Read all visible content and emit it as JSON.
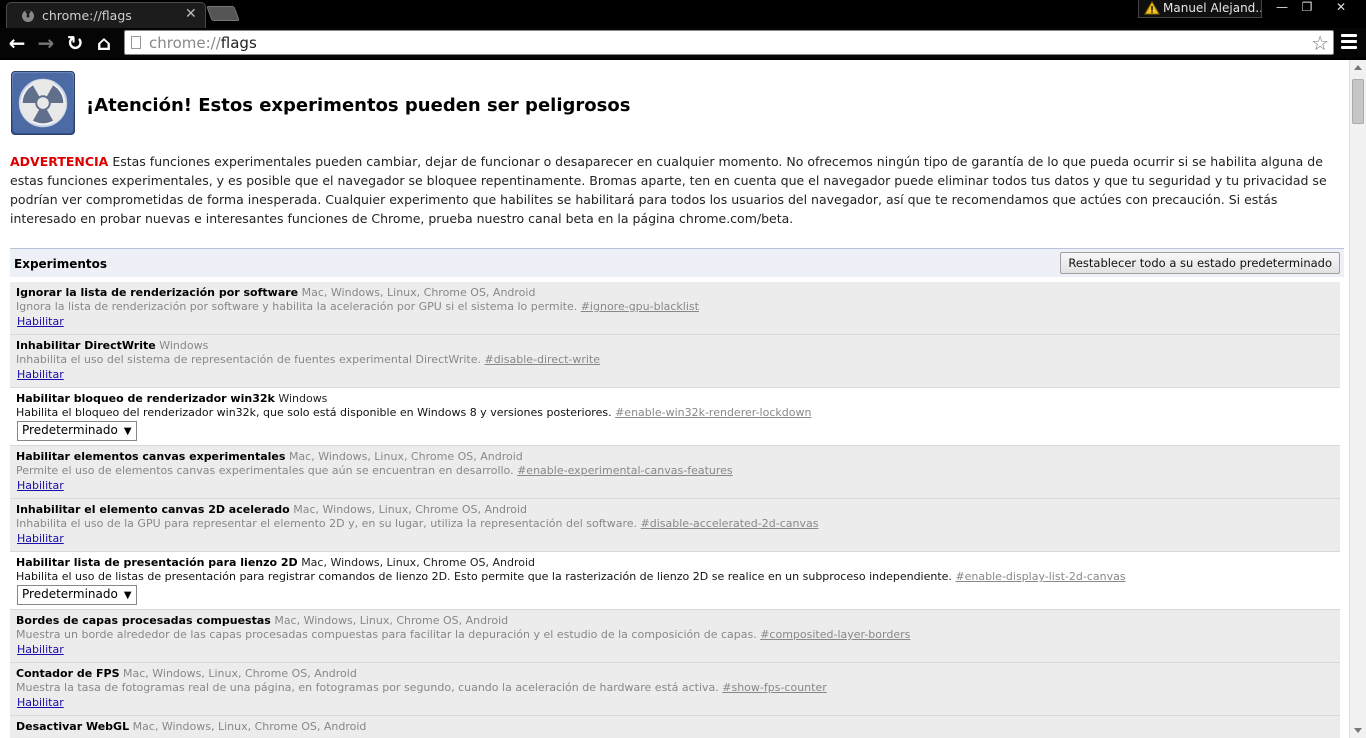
{
  "tab": {
    "title": "chrome://flags"
  },
  "profile": {
    "name": "Manuel Alejand..."
  },
  "window": {
    "minimize": "—",
    "restore": "❐",
    "close": "✕"
  },
  "nav": {
    "back": "←",
    "forward": "→",
    "reload": "↻",
    "home": "⌂"
  },
  "omnibox": {
    "scheme": "chrome://",
    "host": "flags"
  },
  "page": {
    "title": "¡Atención! Estos experimentos pueden ser peligrosos",
    "warning_label": "ADVERTENCIA",
    "warning_text": " Estas funciones experimentales pueden cambiar, dejar de funcionar o desaparecer en cualquier momento. No ofrecemos ningún tipo de garantía de lo que pueda ocurrir si se habilita alguna de estas funciones experimentales, y es posible que el navegador se bloquee repentinamente. Bromas aparte, ten en cuenta que el navegador puede eliminar todos tus datos y que tu seguridad y tu privacidad se podrían ver comprometidas de forma inesperada. Cualquier experimento que habilites se habilitará para todos los usuarios del navegador, así que te recomendamos que actúes con precaución. Si estás interesado en probar nuevas e interesantes funciones de Chrome, prueba nuestro canal beta en la página chrome.com/beta.",
    "experiments_label": "Experimentos",
    "reset_label": "Restablecer todo a su estado predeterminado"
  },
  "experiments": [
    {
      "name": "Ignorar la lista de renderización por software",
      "platforms": "Mac, Windows, Linux, Chrome OS, Android",
      "desc": "Ignora la lista de renderización por software y habilita la aceleración por GPU si el sistema lo permite.",
      "anchor": "#ignore-gpu-blacklist",
      "action": "Habilitar"
    },
    {
      "name": "Inhabilitar DirectWrite",
      "platforms": "Windows",
      "desc": "Inhabilita el uso del sistema de representación de fuentes experimental DirectWrite.",
      "anchor": "#disable-direct-write",
      "action": "Habilitar"
    },
    {
      "name": "Habilitar bloqueo de renderizador win32k",
      "platforms": "Windows",
      "desc": "Habilita el bloqueo del renderizador win32k, que solo está disponible en Windows 8 y versiones posteriores.",
      "anchor": "#enable-win32k-renderer-lockdown",
      "select": "Predeterminado"
    },
    {
      "name": "Habilitar elementos canvas experimentales",
      "platforms": "Mac, Windows, Linux, Chrome OS, Android",
      "desc": "Permite el uso de elementos canvas experimentales que aún se encuentran en desarrollo.",
      "anchor": "#enable-experimental-canvas-features",
      "action": "Habilitar"
    },
    {
      "name": "Inhabilitar el elemento canvas 2D acelerado",
      "platforms": "Mac, Windows, Linux, Chrome OS, Android",
      "desc": "Inhabilita el uso de la GPU para representar el elemento 2D y, en su lugar, utiliza la representación del software.",
      "anchor": "#disable-accelerated-2d-canvas",
      "action": "Habilitar"
    },
    {
      "name": "Habilitar lista de presentación para lienzo 2D",
      "platforms": "Mac, Windows, Linux, Chrome OS, Android",
      "desc": "Habilita el uso de listas de presentación para registrar comandos de lienzo 2D. Esto permite que la rasterización de lienzo 2D se realice en un subproceso independiente.",
      "anchor": "#enable-display-list-2d-canvas",
      "select": "Predeterminado"
    },
    {
      "name": "Bordes de capas procesadas compuestas",
      "platforms": "Mac, Windows, Linux, Chrome OS, Android",
      "desc": "Muestra un borde alrededor de las capas procesadas compuestas para facilitar la depuración y el estudio de la composición de capas.",
      "anchor": "#composited-layer-borders",
      "action": "Habilitar"
    },
    {
      "name": "Contador de FPS",
      "platforms": "Mac, Windows, Linux, Chrome OS, Android",
      "desc": "Muestra la tasa de fotogramas real de una página, en fotogramas por segundo, cuando la aceleración de hardware está activa.",
      "anchor": "#show-fps-counter",
      "action": "Habilitar"
    },
    {
      "name": "Desactivar WebGL",
      "platforms": "Mac, Windows, Linux, Chrome OS, Android",
      "desc": "",
      "anchor": "",
      "action": ""
    }
  ]
}
